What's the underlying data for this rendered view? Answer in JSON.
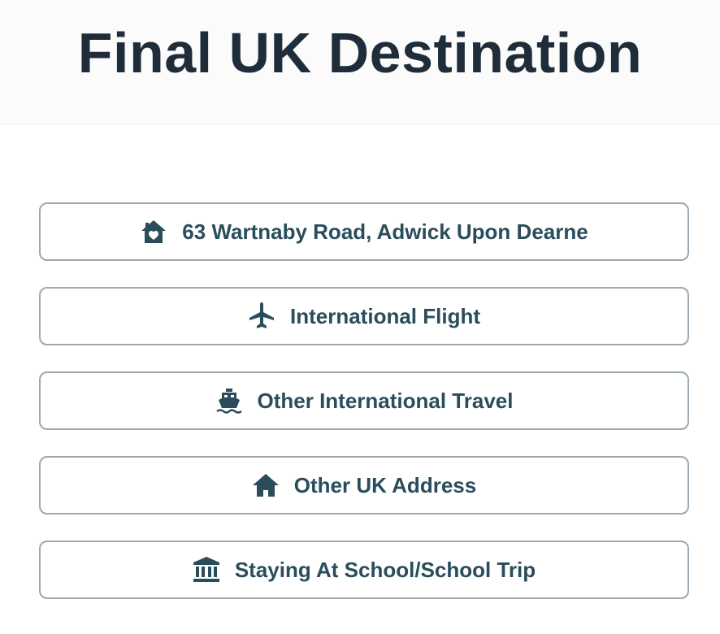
{
  "page": {
    "title": "Final UK Destination"
  },
  "options": [
    {
      "label": "63 Wartnaby Road, Adwick Upon Dearne",
      "icon": "home-heart-icon"
    },
    {
      "label": "International Flight",
      "icon": "airplane-icon"
    },
    {
      "label": "Other International Travel",
      "icon": "ship-icon"
    },
    {
      "label": "Other UK Address",
      "icon": "house-icon"
    },
    {
      "label": "Staying At School/School Trip",
      "icon": "school-building-icon"
    }
  ],
  "colors": {
    "title": "#1f2d3a",
    "accent": "#2a4d5c",
    "border": "#9aa9b3",
    "header_bg": "#fbfbfb"
  }
}
